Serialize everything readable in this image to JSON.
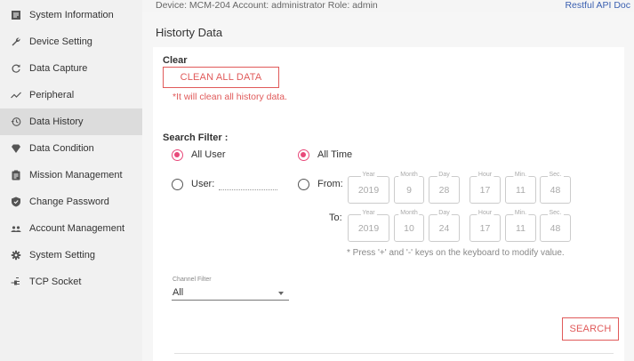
{
  "topbar": {
    "info": "Device: MCM-204   Account: administrator   Role: admin",
    "api_link": "Restful API Doc"
  },
  "sidebar": {
    "items": [
      {
        "label": "System Information",
        "icon": "list-icon"
      },
      {
        "label": "Device Setting",
        "icon": "wrench-icon"
      },
      {
        "label": "Data Capture",
        "icon": "refresh-icon"
      },
      {
        "label": "Peripheral",
        "icon": "trend-icon"
      },
      {
        "label": "Data History",
        "icon": "history-icon",
        "active": true
      },
      {
        "label": "Data Condition",
        "icon": "diamond-icon"
      },
      {
        "label": "Mission Management",
        "icon": "clipboard-icon"
      },
      {
        "label": "Change Password",
        "icon": "shield-icon"
      },
      {
        "label": "Account Management",
        "icon": "people-icon"
      },
      {
        "label": "System Setting",
        "icon": "gear-icon"
      },
      {
        "label": "TCP Socket",
        "icon": "plug-icon"
      }
    ]
  },
  "page": {
    "title": "Historty Data",
    "clear": {
      "label": "Clear",
      "button": "CLEAN ALL DATA",
      "warning": "*It will clean all history data."
    },
    "search_filter": {
      "label": "Search Filter :",
      "all_user": "All User",
      "user": "User:",
      "all_time": "All Time",
      "from": "From:",
      "to": "To:",
      "fields": [
        "Year",
        "Month",
        "Day",
        "Hour",
        "Min.",
        "Sec."
      ],
      "from_values": [
        "2019",
        "9",
        "28",
        "17",
        "11",
        "48"
      ],
      "to_values": [
        "2019",
        "10",
        "24",
        "17",
        "11",
        "48"
      ],
      "hint": "* Press '+' and '-' keys on the keyboard to modify value.",
      "selected_user_option": "All User",
      "selected_time_option": "All Time"
    },
    "channel_filter": {
      "label": "Channel Filter",
      "value": "All"
    },
    "search_button": "SEARCH"
  },
  "colors": {
    "accent": "#e05a5a",
    "radio": "#e8497a",
    "link": "#3a5fb0"
  }
}
